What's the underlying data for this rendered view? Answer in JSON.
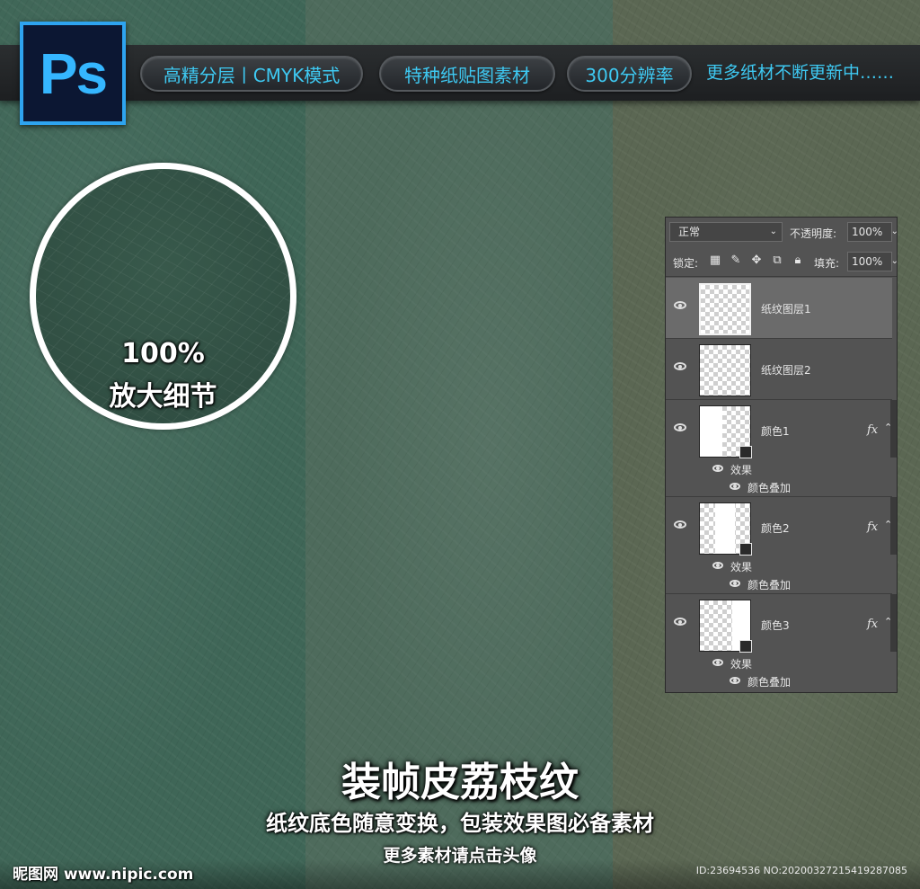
{
  "banner": {
    "logo": "Ps",
    "pills": [
      "高精分层丨CMYK模式",
      "特种纸贴图素材",
      "300分辨率"
    ],
    "note": "更多纸材不断更新中……"
  },
  "zoom": {
    "percent": "100%",
    "label": "放大细节"
  },
  "layers_panel": {
    "blend_mode": "正常",
    "opacity_label": "不透明度:",
    "opacity_value": "100%",
    "lock_label": "锁定:",
    "fill_label": "填充:",
    "fill_value": "100%",
    "lock_icons": [
      "checker-lock-icon",
      "brush-lock-icon",
      "move-lock-icon",
      "artboard-lock-icon",
      "padlock-icon"
    ],
    "layers": [
      {
        "name": "纸纹图层1",
        "selected": true
      },
      {
        "name": "纸纹图层2",
        "selected": false
      },
      {
        "name": "颜色1",
        "fx": "fx",
        "effects_label": "效果",
        "effect": "颜色叠加"
      },
      {
        "name": "颜色2",
        "fx": "fx",
        "effects_label": "效果",
        "effect": "颜色叠加"
      },
      {
        "name": "颜色3",
        "fx": "fx",
        "effects_label": "效果",
        "effect": "颜色叠加"
      }
    ]
  },
  "footer": {
    "title": "装帧皮荔枝纹",
    "subtitle": "纸纹底色随意变换，包装效果图必备素材",
    "note": "更多素材请点击头像",
    "watermark": "昵图网 www.nipic.com",
    "id_text": "ID:23694536 NO:20200327215419287085"
  },
  "colors": {
    "panel_left": "#3f6657",
    "panel_middle": "#4e6b5c",
    "panel_right": "#5b6753",
    "accent_cyan": "#3ec9f2",
    "ps_blue": "#2ea4f0"
  }
}
